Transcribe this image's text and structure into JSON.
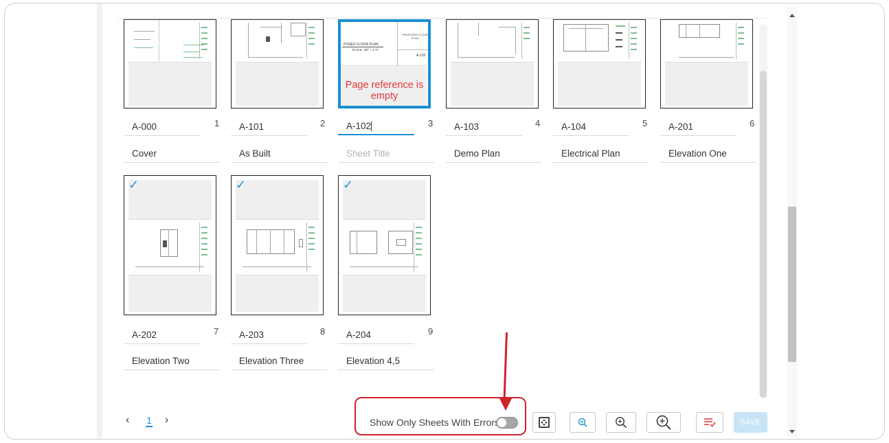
{
  "sheets": [
    {
      "number": "A-000",
      "index": "1",
      "title": "Cover",
      "title_is_placeholder": false,
      "error": ""
    },
    {
      "number": "A-101",
      "index": "2",
      "title": "As Built",
      "title_is_placeholder": false,
      "error": ""
    },
    {
      "number": "A-102",
      "index": "3",
      "title": "Sheet Title",
      "title_is_placeholder": true,
      "error": "Page reference is empty",
      "thumb_text_1": "POSED FLOOR PLAN",
      "thumb_text_2": "SCALE: 3/8\" = 1'-0\"",
      "thumb_text_3": "PROPOSED FLOOR PLAN",
      "thumb_text_4": "A-102"
    },
    {
      "number": "A-103",
      "index": "4",
      "title": "Demo Plan",
      "title_is_placeholder": false,
      "error": ""
    },
    {
      "number": "A-104",
      "index": "5",
      "title": "Electrical Plan",
      "title_is_placeholder": false,
      "error": ""
    },
    {
      "number": "A-201",
      "index": "6",
      "title": "Elevation One",
      "title_is_placeholder": false,
      "error": ""
    },
    {
      "number": "A-202",
      "index": "7",
      "title": "Elevation Two",
      "title_is_placeholder": false,
      "error": "",
      "checked": true
    },
    {
      "number": "A-203",
      "index": "8",
      "title": "Elevation Three",
      "title_is_placeholder": false,
      "error": "",
      "checked": true
    },
    {
      "number": "A-204",
      "index": "9",
      "title": "Elevation 4,5",
      "title_is_placeholder": false,
      "error": "",
      "checked": true
    }
  ],
  "check_glyph": "✓",
  "pagination": {
    "prev": "‹",
    "current": "1",
    "next": "›"
  },
  "filter": {
    "label": "Show Only Sheets With Errors",
    "enabled": false
  },
  "toolbar": {
    "fit_icon": "fit-page-icon",
    "zoom_small_icon": "zoom-in-small-icon",
    "zoom_medium_icon": "zoom-in-medium-icon",
    "zoom_large_icon": "zoom-in-large-icon",
    "list_icon": "list-check-icon",
    "save_label": "SAVE"
  },
  "colors": {
    "accent": "#1b8fd4",
    "error": "#e0393b",
    "annotation": "#d0222a",
    "check": "#2d95d5"
  }
}
